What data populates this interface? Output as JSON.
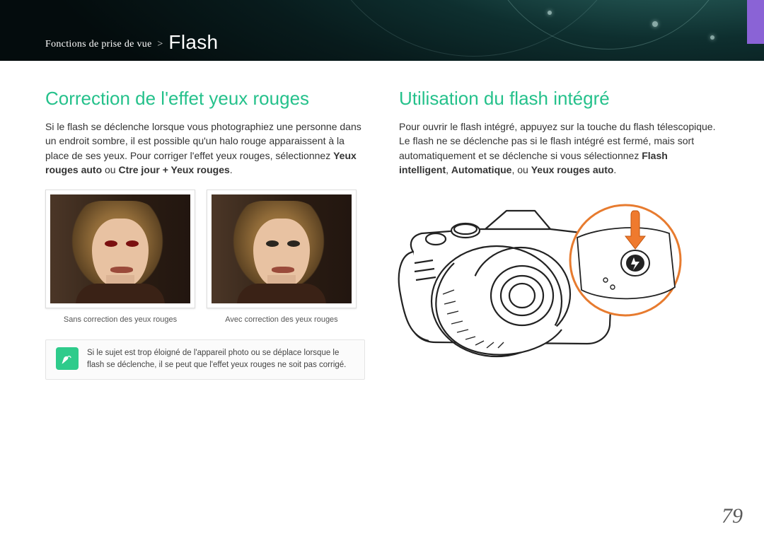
{
  "page_number": "79",
  "breadcrumb": {
    "category": "Fonctions de prise de vue",
    "separator": ">",
    "section": "Flash"
  },
  "left": {
    "title": "Correction de l'effet yeux rouges",
    "p1": "Si le flash se déclenche lorsque vous photographiez une personne dans un endroit sombre, il est possible qu'un halo rouge apparaissent à la place de ses yeux. Pour corriger l'effet yeux rouges, sélectionnez ",
    "opt1": "Yeux rouges auto",
    "or": " ou ",
    "opt2": "Ctre jour + Yeux rouges",
    "period": ".",
    "caption_before": "Sans correction des yeux rouges",
    "caption_after": "Avec correction des yeux rouges",
    "note": "Si le sujet est trop éloigné de l'appareil photo ou se déplace lorsque le flash se déclenche, il se peut que l'effet yeux rouges ne soit pas corrigé."
  },
  "right": {
    "title": "Utilisation du flash intégré",
    "p1": "Pour ouvrir le flash intégré, appuyez sur la touche du flash télescopique. Le flash ne se déclenche pas si le flash intégré est fermé, mais sort automatiquement et se déclenche si vous sélectionnez ",
    "opt1": "Flash intelligent",
    "sep1": ", ",
    "opt2": "Automatique",
    "sep2": ", ou ",
    "opt3": "Yeux rouges auto",
    "period": "."
  },
  "icons": {
    "note": "pen-icon",
    "flash_button": "flash-bolt-icon"
  },
  "colors": {
    "accent_green": "#25c18b",
    "note_icon_bg": "#2ecb8b",
    "tab_purple": "#8a63d6",
    "callout_orange": "#e77b2f"
  }
}
